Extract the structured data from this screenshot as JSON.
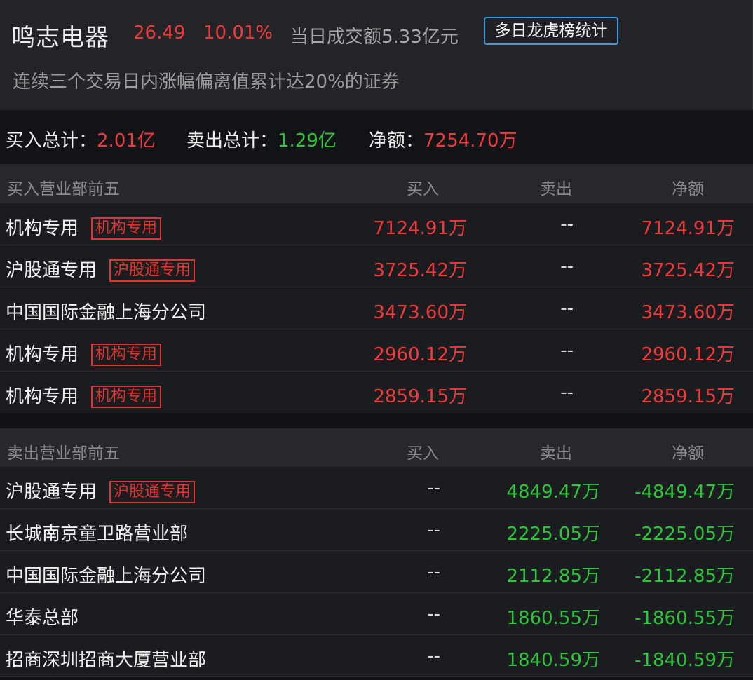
{
  "stock": {
    "name": "鸣志电器",
    "price": "26.49",
    "change_pct": "10.01%",
    "turnover": "当日成交额5.33亿元",
    "multi_day_button": "多日龙虎榜统计",
    "reason": "连续三个交易日内涨幅偏离值累计达20%的证券"
  },
  "summary": {
    "buy_label": "买入总计：",
    "buy_value": "2.01亿",
    "sell_label": "卖出总计：",
    "sell_value": "1.29亿",
    "net_label": "净额：",
    "net_value": "7254.70万"
  },
  "buy_section": {
    "title": "买入营业部前五",
    "col_buy": "买入",
    "col_sell": "卖出",
    "col_net": "净额",
    "rows": [
      {
        "name": "机构专用",
        "tag": "机构专用",
        "buy": "7124.91万",
        "sell": "--",
        "net": "7124.91万"
      },
      {
        "name": "沪股通专用",
        "tag": "沪股通专用",
        "buy": "3725.42万",
        "sell": "--",
        "net": "3725.42万"
      },
      {
        "name": "中国国际金融上海分公司",
        "tag": "",
        "buy": "3473.60万",
        "sell": "--",
        "net": "3473.60万"
      },
      {
        "name": "机构专用",
        "tag": "机构专用",
        "buy": "2960.12万",
        "sell": "--",
        "net": "2960.12万"
      },
      {
        "name": "机构专用",
        "tag": "机构专用",
        "buy": "2859.15万",
        "sell": "--",
        "net": "2859.15万"
      }
    ]
  },
  "sell_section": {
    "title": "卖出营业部前五",
    "col_buy": "买入",
    "col_sell": "卖出",
    "col_net": "净额",
    "rows": [
      {
        "name": "沪股通专用",
        "tag": "沪股通专用",
        "buy": "--",
        "sell": "4849.47万",
        "net": "-4849.47万"
      },
      {
        "name": "长城南京童卫路营业部",
        "tag": "",
        "buy": "--",
        "sell": "2225.05万",
        "net": "-2225.05万"
      },
      {
        "name": "中国国际金融上海分公司",
        "tag": "",
        "buy": "--",
        "sell": "2112.85万",
        "net": "-2112.85万"
      },
      {
        "name": "华泰总部",
        "tag": "",
        "buy": "--",
        "sell": "1860.55万",
        "net": "-1860.55万"
      },
      {
        "name": "招商深圳招商大厦营业部",
        "tag": "",
        "buy": "--",
        "sell": "1840.59万",
        "net": "-1840.59万"
      }
    ]
  },
  "colors": {
    "up": "#f03a3a",
    "down": "#2fc43a",
    "accent": "#3a9be0"
  }
}
